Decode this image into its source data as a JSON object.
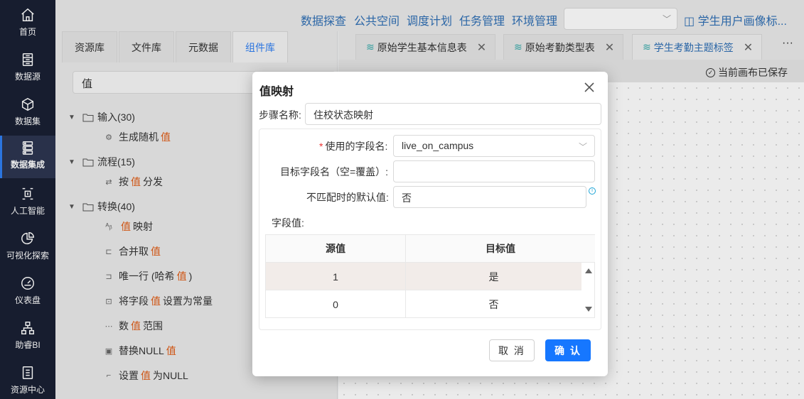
{
  "nav": {
    "items": [
      {
        "label": "首页",
        "icon": "home-icon"
      },
      {
        "label": "数据源",
        "icon": "database-icon"
      },
      {
        "label": "数据集",
        "icon": "cube-icon"
      },
      {
        "label": "数据集成",
        "icon": "server-icon",
        "active": true
      },
      {
        "label": "人工智能",
        "icon": "ai-icon"
      },
      {
        "label": "可视化探索",
        "icon": "pie-chart-icon"
      },
      {
        "label": "仪表盘",
        "icon": "gauge-icon"
      },
      {
        "label": "助睿BI",
        "icon": "org-chart-icon"
      },
      {
        "label": "资源中心",
        "icon": "resource-icon"
      }
    ]
  },
  "topbar": {
    "links": [
      "数据探查",
      "公共空间",
      "调度计划",
      "任务管理",
      "环境管理"
    ],
    "select_value": "",
    "user_view": "学生用户画像标..."
  },
  "left_panel": {
    "tabs": [
      "资源库",
      "文件库",
      "元数据",
      "组件库"
    ],
    "active_tab": "组件库",
    "search_value": "值",
    "tree": {
      "input_group": "输入(30)",
      "input_items": [
        {
          "pre": "生成随机",
          "hl": "值",
          "post": ""
        }
      ],
      "flow_group": "流程(15)",
      "flow_items": [
        {
          "pre": "按",
          "hl": "值",
          "post": "分发"
        }
      ],
      "transform_group": "转换(40)",
      "transform_items": [
        {
          "pre": "",
          "hl": "值",
          "post": "映射"
        },
        {
          "pre": "合并取",
          "hl": "值",
          "post": ""
        },
        {
          "pre": "唯一行 (哈希",
          "hl": "值",
          "post": ")"
        },
        {
          "pre": "将字段",
          "hl": "值",
          "post": "设置为常量"
        },
        {
          "pre": "数",
          "hl": "值",
          "post": "范围"
        },
        {
          "pre": "替换NULL",
          "hl": "值",
          "post": ""
        },
        {
          "pre": "设置",
          "hl": "值",
          "post": "为NULL"
        }
      ]
    }
  },
  "work_tabs": [
    {
      "label": "原始学生基本信息表",
      "active": false
    },
    {
      "label": "原始考勤类型表",
      "active": false
    },
    {
      "label": "学生考勤主题标签",
      "active": true
    }
  ],
  "work_more": "···",
  "save_status": "当前画布已保存",
  "dialog": {
    "title": "值映射",
    "step_name_label": "步骤名称:",
    "step_name_value": "住校状态映射",
    "field_name_label": "使用的字段名:",
    "field_name_required": "*",
    "field_name_value": "live_on_campus",
    "target_field_label": "目标字段名（空=覆盖）:",
    "target_field_value": "",
    "default_label": "不匹配时的默认值:",
    "default_value": "否",
    "field_values_label": "字段值:",
    "table": {
      "headers": [
        "源值",
        "目标值"
      ],
      "rows": [
        {
          "source": "1",
          "target": "是"
        },
        {
          "source": "0",
          "target": "否"
        }
      ]
    },
    "cancel_label": "取 消",
    "ok_label": "确 认"
  }
}
